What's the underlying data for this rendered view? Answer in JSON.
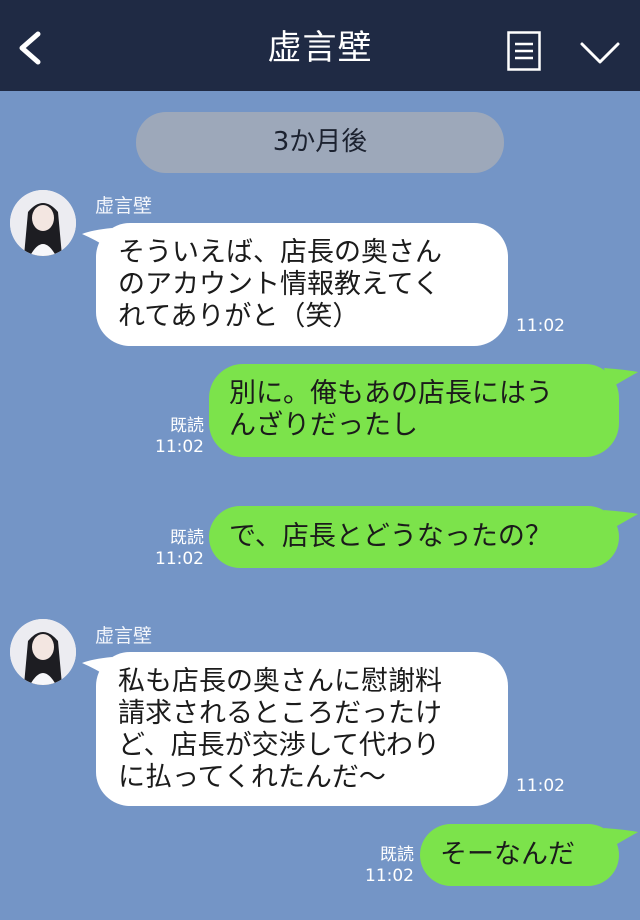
{
  "header": {
    "title": "虚言壁"
  },
  "date_separator": "3か月後",
  "messages": [
    {
      "sender": "虚言壁",
      "text_lines": [
        "そういえば、店長の奥さん",
        "のアカウント情報教えてく",
        "れてありがと（笑）"
      ],
      "time": "11:02"
    },
    {
      "text_lines": [
        "別に。俺もあの店長にはう",
        "んざりだったし"
      ],
      "read": "既読",
      "time": "11:02"
    },
    {
      "text_lines": [
        "で、店長とどうなったの？"
      ],
      "read": "既読",
      "time": "11:02"
    },
    {
      "sender": "虚言壁",
      "text_lines": [
        "私も店長の奥さんに慰謝料",
        "請求されるところだったけ",
        "ど、店長が交渉して代わり",
        "に払ってくれたんだ〜"
      ],
      "time": "11:02"
    },
    {
      "text_lines": [
        "そーなんだ"
      ],
      "read": "既読",
      "time": "11:02"
    }
  ],
  "icons": [
    "back-arrow-icon",
    "menu-list-icon",
    "chevron-down-icon"
  ]
}
